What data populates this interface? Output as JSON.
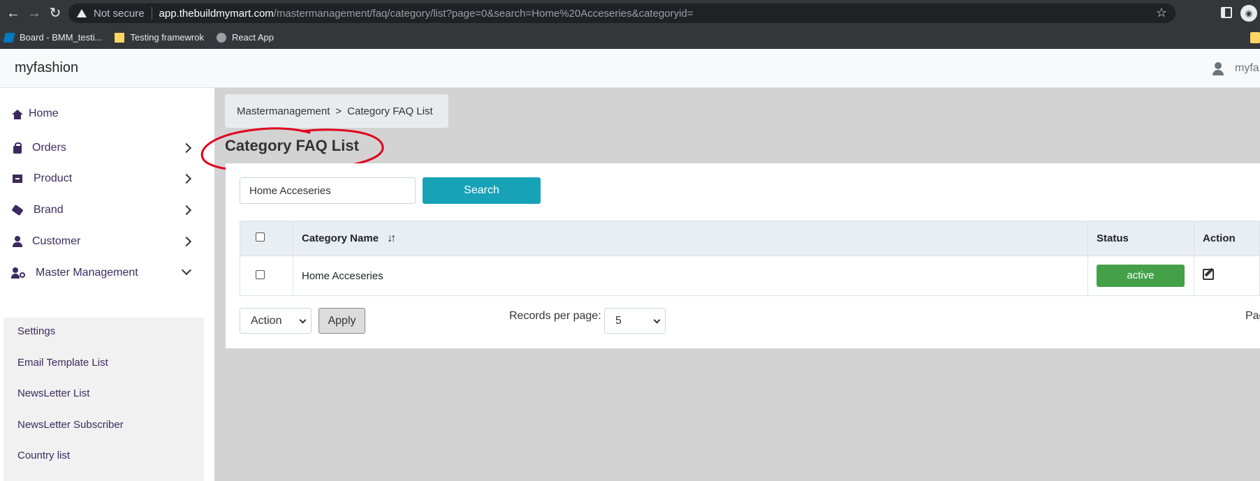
{
  "browser": {
    "security_label": "Not secure",
    "url_host": "app.thebuildmymart.com",
    "url_path": "/mastermanagement/faq/category/list?page=0&search=Home%20Acceseries&categoryid=",
    "bookmarks": [
      {
        "label": "Board - BMM_testi...",
        "icon": "trello-icon"
      },
      {
        "label": "Testing framewrok",
        "icon": "folder-icon"
      },
      {
        "label": "React App",
        "icon": "globe-icon"
      }
    ]
  },
  "header": {
    "brand": "myfashion",
    "user_name": "myfa"
  },
  "sidebar": {
    "items": [
      {
        "label": "Home",
        "icon": "home-icon"
      },
      {
        "label": "Orders",
        "icon": "shopping-bag-icon"
      },
      {
        "label": "Product",
        "icon": "archive-box-icon"
      },
      {
        "label": "Brand",
        "icon": "tags-icon"
      },
      {
        "label": "Customer",
        "icon": "user-icon"
      },
      {
        "label": "Master Management",
        "icon": "user-cog-icon"
      }
    ],
    "submenu": [
      {
        "label": "Settings"
      },
      {
        "label": "Email Template List"
      },
      {
        "label": "NewsLetter List"
      },
      {
        "label": "NewsLetter Subscriber"
      },
      {
        "label": "Country list"
      }
    ]
  },
  "breadcrumb": {
    "parent": "Mastermanagement",
    "separator": ">",
    "current": "Category FAQ List"
  },
  "page": {
    "title": "Category FAQ List"
  },
  "search": {
    "value": "Home Acceseries",
    "button_label": "Search"
  },
  "table": {
    "headers": {
      "name": "Category Name",
      "sort_glyph": "↓↑",
      "status": "Status",
      "action": "Action"
    },
    "rows": [
      {
        "name": "Home Acceseries",
        "status": "active"
      }
    ]
  },
  "footer": {
    "action_select": "Action",
    "apply_label": "Apply",
    "records_label": "Records per page:",
    "records_value": "5",
    "page_label": "Pag"
  },
  "colors": {
    "accent": "#17a2b8",
    "status_active": "#43a047",
    "annotation": "#e0001b"
  }
}
